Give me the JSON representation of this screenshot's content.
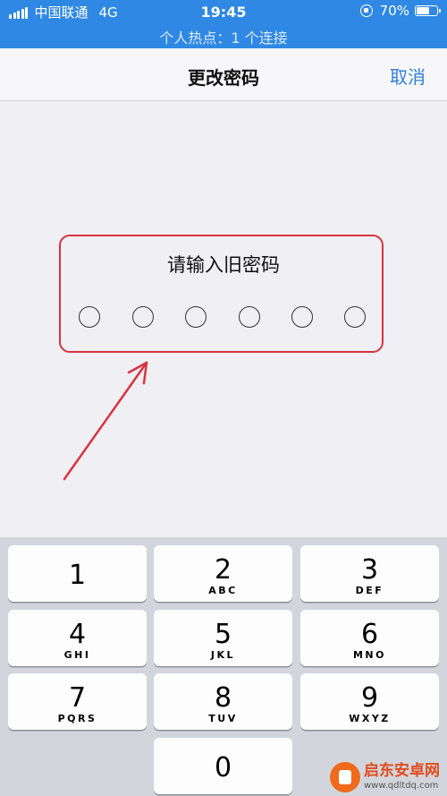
{
  "status_bar": {
    "carrier": "中国联通",
    "network": "4G",
    "time": "19:45",
    "battery_percent": "70%",
    "battery_level": 0.7,
    "hotspot": "个人热点：1 个连接"
  },
  "nav": {
    "title": "更改密码",
    "cancel_label": "取消"
  },
  "prompt": {
    "label": "请输入旧密码",
    "dot_count": 6,
    "highlight_color": "#d8333e"
  },
  "keypad": {
    "keys": [
      {
        "digit": "1",
        "letters": ""
      },
      {
        "digit": "2",
        "letters": "ABC"
      },
      {
        "digit": "3",
        "letters": "DEF"
      },
      {
        "digit": "4",
        "letters": "GHI"
      },
      {
        "digit": "5",
        "letters": "JKL"
      },
      {
        "digit": "6",
        "letters": "MNO"
      },
      {
        "digit": "7",
        "letters": "PQRS"
      },
      {
        "digit": "8",
        "letters": "TUV"
      },
      {
        "digit": "9",
        "letters": "WXYZ"
      },
      {
        "digit": "0",
        "letters": ""
      }
    ]
  },
  "watermark": {
    "name": "启东安卓网",
    "url": "www.qdltdq.com"
  },
  "colors": {
    "status_bar": "#2f88e3",
    "accent": "#2f7fd9",
    "annotation": "#d8333e",
    "background": "#efeff4"
  }
}
